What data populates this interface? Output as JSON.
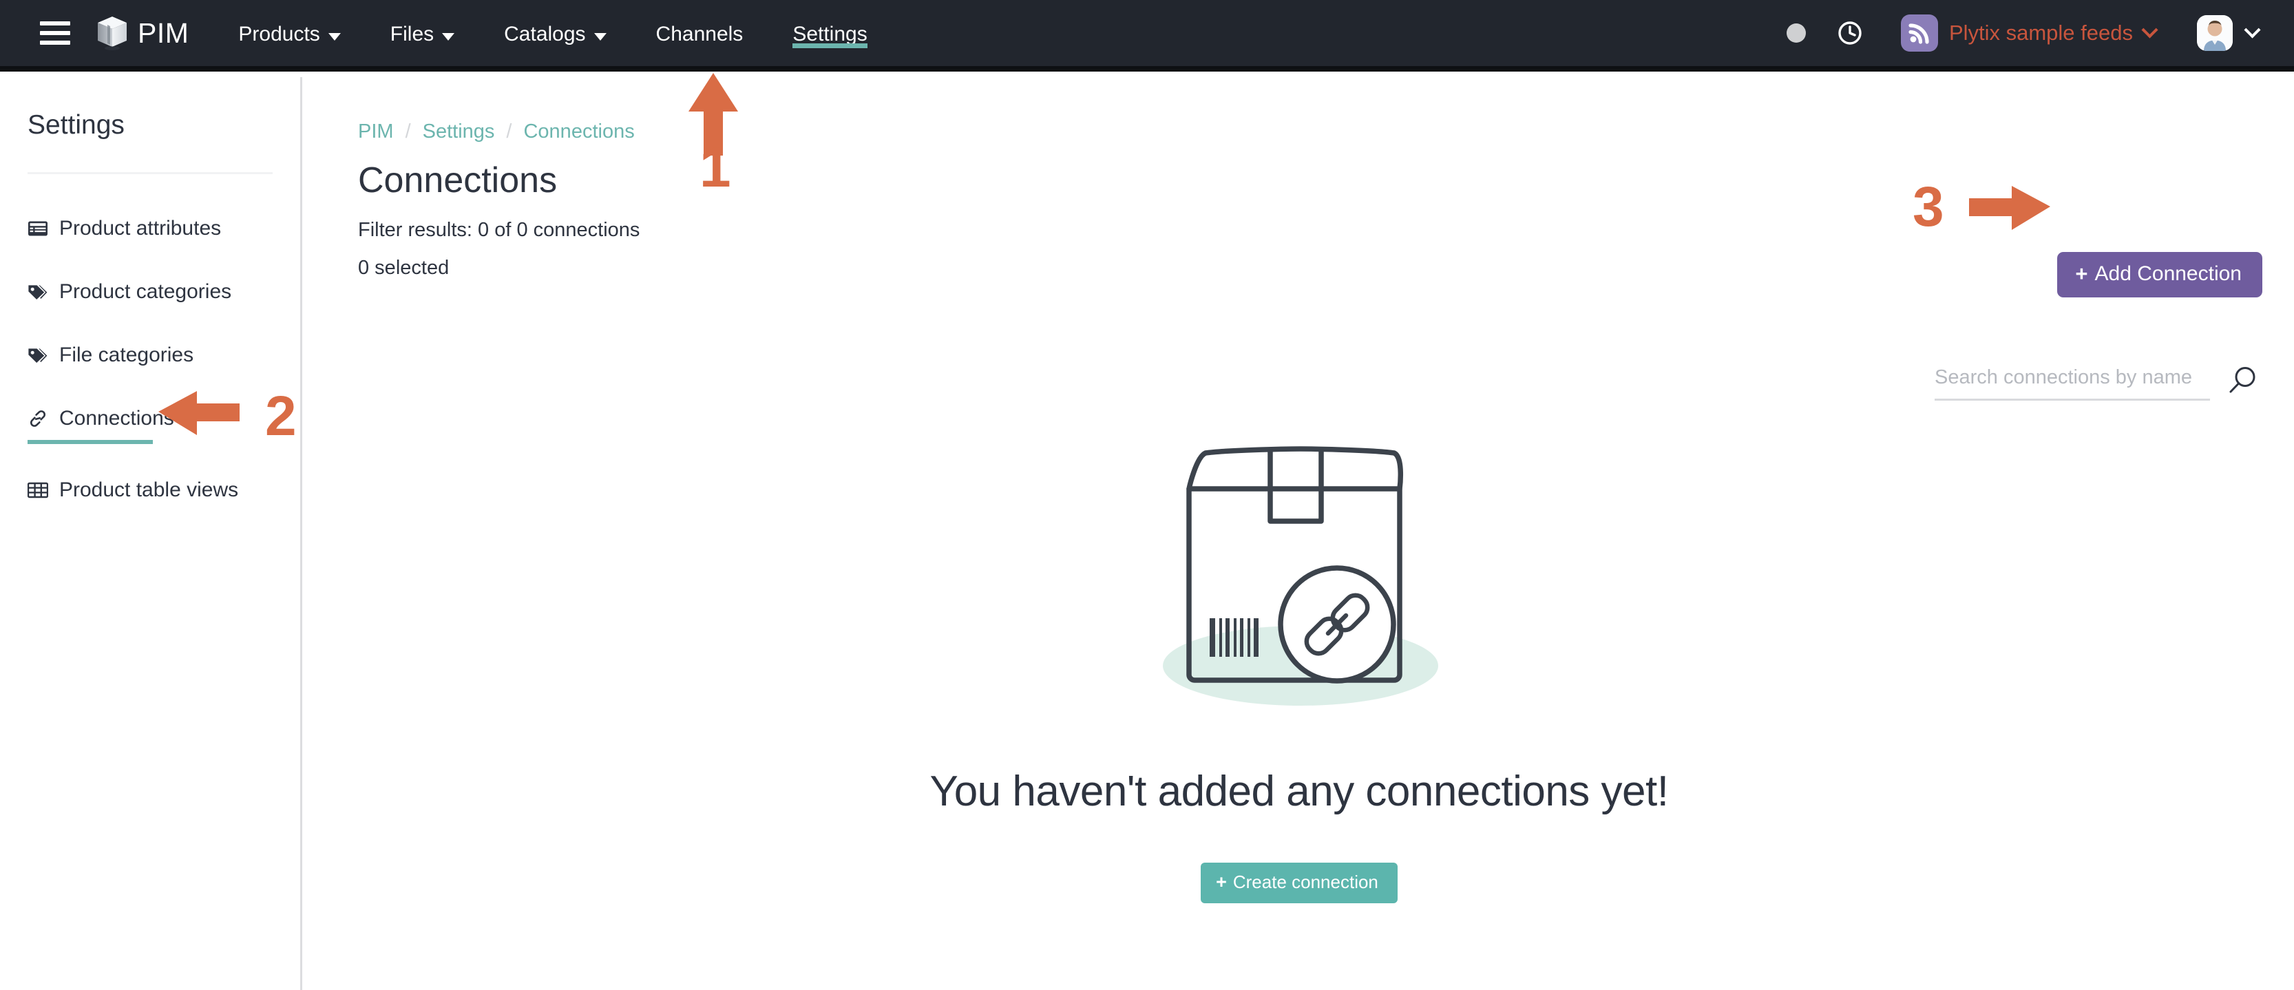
{
  "navbar": {
    "menu_icon": "hamburger-icon",
    "brand": "PIM",
    "brand_icon": "cube-logo-icon",
    "items": [
      {
        "label": "Products",
        "has_caret": true,
        "active": false
      },
      {
        "label": "Files",
        "has_caret": true,
        "active": false
      },
      {
        "label": "Catalogs",
        "has_caret": true,
        "active": false
      },
      {
        "label": "Channels",
        "has_caret": false,
        "active": false
      },
      {
        "label": "Settings",
        "has_caret": false,
        "active": true
      }
    ],
    "status_dot": "status-dot-icon",
    "history_icon": "clock-icon",
    "feed": {
      "icon": "rss-feed-icon",
      "label": "Plytix sample feeds",
      "caret": "chevron-down-icon"
    },
    "user": {
      "avatar": "user-avatar",
      "caret": "chevron-down-icon"
    }
  },
  "sidebar": {
    "title": "Settings",
    "items": [
      {
        "label": "Product attributes",
        "icon": "list-icon",
        "active": false
      },
      {
        "label": "Product categories",
        "icon": "tags-icon",
        "active": false
      },
      {
        "label": "File categories",
        "icon": "tags-icon",
        "active": false
      },
      {
        "label": "Connections",
        "icon": "link-icon",
        "active": true
      },
      {
        "label": "Product table views",
        "icon": "table-icon",
        "active": false
      }
    ]
  },
  "main": {
    "breadcrumb": [
      {
        "label": "PIM"
      },
      {
        "label": "Settings"
      },
      {
        "label": "Connections"
      }
    ],
    "breadcrumb_separator": "/",
    "page_title": "Connections",
    "filter_results": "Filter results: 0 of 0 connections",
    "selected_count": "0 selected",
    "add_button": {
      "label": "Add Connection",
      "icon": "plus-icon",
      "plus": "+"
    },
    "search": {
      "placeholder": "Search connections by name",
      "value": "",
      "icon": "search-icon"
    },
    "empty_state": {
      "illustration": "package-box-with-link-badge-illustration",
      "title": "You haven't added any connections yet!",
      "button": {
        "label": "Create connection",
        "icon": "plus-icon",
        "plus": "+"
      }
    }
  },
  "annotations": [
    {
      "number": "1",
      "icon": "arrow-up-icon",
      "target": "settings-nav-item"
    },
    {
      "number": "2",
      "icon": "arrow-left-icon",
      "target": "sidebar-item-connections"
    },
    {
      "number": "3",
      "icon": "arrow-right-icon",
      "target": "add-connection-button"
    }
  ],
  "colors": {
    "navbar_bg": "#22262e",
    "accent_teal": "#6cb5ae",
    "accent_purple": "#6f5c9e",
    "accent_orange": "#d96c45",
    "feed_text": "#c8553d",
    "text_dark": "#2e3440"
  }
}
